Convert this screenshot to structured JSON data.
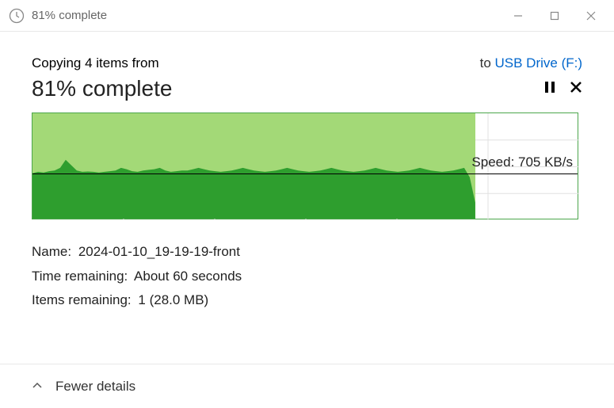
{
  "titlebar": {
    "title": "81% complete"
  },
  "header": {
    "copying_prefix": "Copying 4 items from",
    "to_label": "to ",
    "destination": "USB Drive (F:)"
  },
  "progress": {
    "percent_text": "81% complete"
  },
  "chart_data": {
    "type": "area",
    "title": "",
    "xlabel": "",
    "ylabel": "",
    "ylim": [
      0,
      1600
    ],
    "midline_value": 705,
    "speed_label": "Speed: 705 KB/s",
    "progress_fraction": 0.81,
    "x": [
      0,
      1,
      2,
      3,
      4,
      5,
      6,
      7,
      8,
      9,
      10,
      11,
      12,
      13,
      14,
      15,
      16,
      17,
      18,
      19,
      20,
      21,
      22,
      23,
      24,
      25,
      26,
      27,
      28,
      29,
      30,
      31,
      32,
      33,
      34,
      35,
      36,
      37,
      38,
      39,
      40,
      41,
      42,
      43,
      44,
      45,
      46,
      47,
      48,
      49,
      50,
      51,
      52,
      53,
      54,
      55,
      56,
      57,
      58,
      59,
      60,
      61,
      62,
      63,
      64,
      65,
      66,
      67,
      68,
      69,
      70,
      71,
      72,
      73,
      74,
      75,
      76,
      77,
      78,
      79,
      80
    ],
    "values": [
      680,
      700,
      690,
      710,
      720,
      760,
      880,
      800,
      720,
      700,
      705,
      700,
      690,
      700,
      710,
      720,
      760,
      740,
      710,
      700,
      720,
      730,
      740,
      760,
      720,
      700,
      710,
      720,
      720,
      740,
      760,
      740,
      720,
      710,
      700,
      710,
      720,
      740,
      760,
      740,
      720,
      710,
      700,
      710,
      720,
      740,
      760,
      740,
      720,
      710,
      700,
      710,
      720,
      740,
      760,
      740,
      720,
      710,
      700,
      710,
      720,
      740,
      760,
      740,
      720,
      710,
      700,
      710,
      720,
      740,
      760,
      740,
      720,
      710,
      700,
      710,
      720,
      740,
      760,
      620,
      240
    ]
  },
  "details": {
    "name_label": "Name:",
    "name_value": "2024-01-10_19-19-19-front",
    "time_label": "Time remaining:",
    "time_value": "About 60 seconds",
    "items_label": "Items remaining:",
    "items_value": "1 (28.0 MB)"
  },
  "footer": {
    "fewer_details": "Fewer details"
  }
}
